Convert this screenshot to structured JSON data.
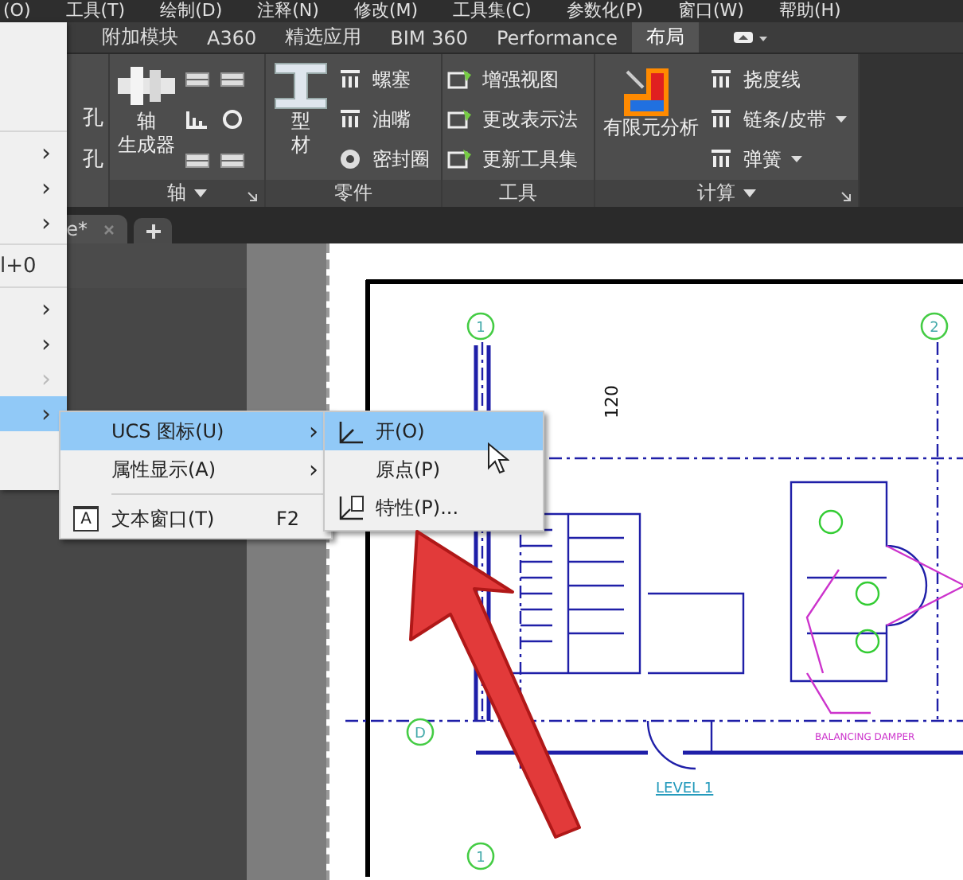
{
  "menu_bar": {
    "items": [
      "(O)",
      "工具(T)",
      "绘制(D)",
      "注释(N)",
      "修改(M)",
      "工具集(C)",
      "参数化(P)",
      "窗口(W)",
      "帮助(H)"
    ]
  },
  "ribbon": {
    "tabs": [
      {
        "label": "附加模块",
        "selected": false
      },
      {
        "label": "A360",
        "selected": false
      },
      {
        "label": "精选应用",
        "selected": false
      },
      {
        "label": "BIM 360",
        "selected": false
      },
      {
        "label": "Performance",
        "selected": false
      },
      {
        "label": "布局",
        "selected": true
      }
    ],
    "panels": [
      {
        "kind": "cut",
        "items": [
          {
            "label": "孔"
          },
          {
            "label": "孔"
          }
        ]
      },
      {
        "kind": "axis",
        "title": "轴",
        "title_menu": true,
        "launcher": true,
        "big": [
          "轴",
          "生成器"
        ]
      },
      {
        "kind": "parts",
        "title": "零件",
        "title_menu": false,
        "launcher": false,
        "big": [
          "型",
          "材"
        ],
        "items": [
          {
            "label": "螺塞",
            "dropdown": false
          },
          {
            "label": "油嘴",
            "dropdown": false
          },
          {
            "label": "密封圈",
            "dropdown": false
          }
        ]
      },
      {
        "kind": "tools",
        "title": "工具",
        "title_menu": false,
        "launcher": false,
        "items": [
          {
            "label": "增强视图",
            "dropdown": false
          },
          {
            "label": "更改表示法",
            "dropdown": false
          },
          {
            "label": "更新工具集",
            "dropdown": false
          }
        ]
      },
      {
        "kind": "calc",
        "title": "计算",
        "title_menu": true,
        "launcher": true,
        "big": [
          "有限元分析"
        ],
        "items": [
          {
            "label": "挠度线",
            "dropdown": false
          },
          {
            "label": "链条/皮带",
            "dropdown": true
          },
          {
            "label": "弹簧",
            "dropdown": true
          }
        ]
      }
    ]
  },
  "document_tabs": [
    {
      "label": "e*",
      "selected": true
    }
  ],
  "context_menu": {
    "items": [
      {
        "kind": "separator"
      },
      {
        "kind": "submenu",
        "chevron": "›",
        "disabled": false,
        "selected": false
      },
      {
        "kind": "submenu",
        "chevron": "›",
        "disabled": false,
        "selected": false
      },
      {
        "kind": "submenu",
        "chevron": "›",
        "disabled": false,
        "selected": false
      },
      {
        "kind": "separator"
      },
      {
        "kind": "command",
        "shortcut": "l+0",
        "disabled": false,
        "selected": false
      },
      {
        "kind": "separator"
      },
      {
        "kind": "submenu",
        "chevron": "›",
        "disabled": false,
        "selected": false
      },
      {
        "kind": "submenu",
        "chevron": "›",
        "disabled": false,
        "selected": false
      },
      {
        "kind": "submenu",
        "chevron": "›",
        "disabled": true,
        "selected": false
      },
      {
        "kind": "submenu",
        "chevron": "›",
        "disabled": false,
        "selected": true
      },
      {
        "kind": "command",
        "selected": false
      }
    ]
  },
  "submenu": {
    "items": [
      {
        "kind": "submenu",
        "label": "UCS 图标(U)",
        "chevron": "›",
        "selected": true
      },
      {
        "kind": "submenu",
        "label": "属性显示(A)",
        "chevron": "›",
        "selected": false
      },
      {
        "kind": "separator"
      },
      {
        "kind": "command",
        "icon_text": "A",
        "label": "文本窗口(T)",
        "shortcut": "F2",
        "selected": false
      }
    ]
  },
  "ucs_menu": {
    "items": [
      {
        "label": "开(O)",
        "selected": true
      },
      {
        "label": "原点(P)",
        "selected": false
      },
      {
        "label": "特性(P)...",
        "selected": false
      }
    ]
  },
  "drawing": {
    "grid_bubbles": [
      "1",
      "2",
      "D",
      "1"
    ],
    "dimension": "120",
    "level_title": "LEVEL 1",
    "note": "BALANCING DAMPER"
  }
}
